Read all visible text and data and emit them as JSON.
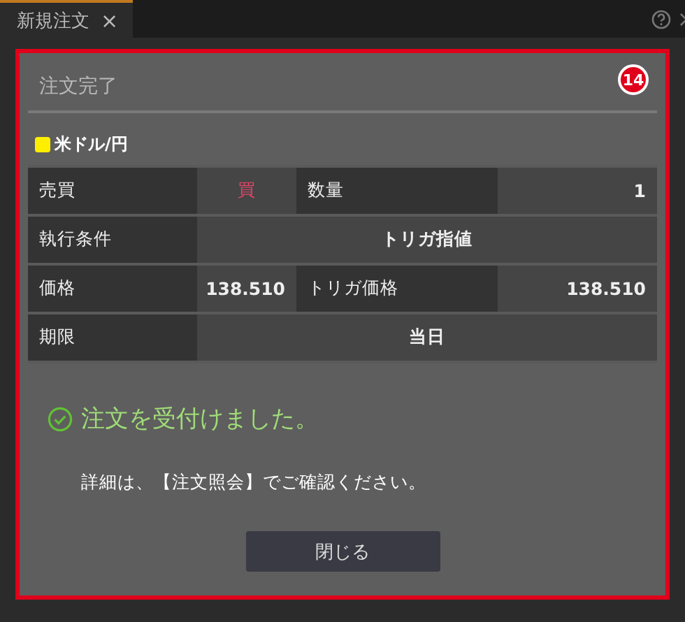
{
  "tab": {
    "label": "新規注文",
    "close": "×",
    "selected": true
  },
  "dialog": {
    "title": "注文完了",
    "badge": "14",
    "pair": {
      "name": "米ドル/円",
      "color": "#ffee00"
    },
    "table": {
      "rows": [
        {
          "cells": [
            {
              "kind": "label",
              "text": "売買"
            },
            {
              "kind": "buy",
              "text": "買"
            },
            {
              "kind": "label",
              "text": "数量"
            },
            {
              "kind": "value",
              "text": "1"
            }
          ]
        },
        {
          "cells": [
            {
              "kind": "label",
              "text": "執行条件"
            },
            {
              "kind": "wide",
              "text": "トリガ指値"
            }
          ]
        },
        {
          "cells": [
            {
              "kind": "label",
              "text": "価格"
            },
            {
              "kind": "value",
              "text": "138.510"
            },
            {
              "kind": "label",
              "text": "トリガ価格"
            },
            {
              "kind": "value",
              "text": "138.510"
            }
          ]
        },
        {
          "cells": [
            {
              "kind": "label",
              "text": "期限"
            },
            {
              "kind": "wide",
              "text": "当日"
            }
          ]
        }
      ]
    },
    "success": "注文を受付けました。",
    "detail": "詳細は、【注文照会】でご確認ください。",
    "close_button": "閉じる"
  }
}
